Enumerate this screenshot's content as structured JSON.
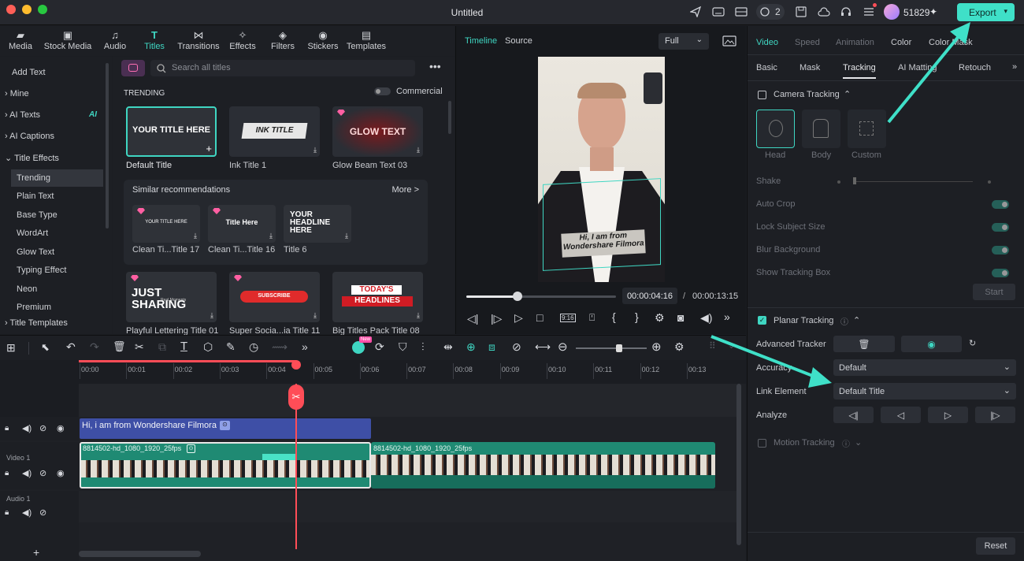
{
  "window": {
    "title": "Untitled",
    "count": "2",
    "credits": "51829",
    "export_label": "Export"
  },
  "colors": {
    "accent": "#3fd6c2",
    "export_bg": "#3fe0c8",
    "title_clip": "#3e4fa6",
    "video_clip": "#1f8a73",
    "playhead": "#ff4d57"
  },
  "media_tabs": [
    {
      "label": "Media",
      "icon": "folder-icon"
    },
    {
      "label": "Stock Media",
      "icon": "stock-icon"
    },
    {
      "label": "Audio",
      "icon": "music-icon"
    },
    {
      "label": "Titles",
      "icon": "title-icon"
    },
    {
      "label": "Transitions",
      "icon": "transition-icon"
    },
    {
      "label": "Effects",
      "icon": "effects-icon"
    },
    {
      "label": "Filters",
      "icon": "filters-icon"
    },
    {
      "label": "Stickers",
      "icon": "stickers-icon"
    },
    {
      "label": "Templates",
      "icon": "templates-icon"
    }
  ],
  "left_nav": {
    "add_text": "Add Text",
    "mine": "Mine",
    "ai_texts": "AI Texts",
    "ai_badge": "AI",
    "ai_captions": "AI Captions",
    "title_effects": "Title Effects",
    "sub": [
      "Trending",
      "Plain Text",
      "Base Type",
      "WordArt",
      "Glow Text",
      "Typing Effect",
      "Neon",
      "Premium"
    ],
    "title_templates": "Title Templates"
  },
  "titles": {
    "search_placeholder": "Search all titles",
    "commercial": "Commercial",
    "trending": "TRENDING",
    "similar": "Similar recommendations",
    "more": "More >",
    "row1": [
      {
        "caption": "Default Title",
        "preview": "YOUR TITLE HERE"
      },
      {
        "caption": "Ink Title 1",
        "preview": "INK TITLE"
      },
      {
        "caption": "Glow Beam Text 03",
        "preview": "GLOW TEXT"
      }
    ],
    "similar_items": [
      {
        "caption": "Clean Ti...Title 17",
        "preview": "YOUR TITLE HERE"
      },
      {
        "caption": "Clean Ti...Title 16",
        "preview": "Title Here"
      },
      {
        "caption": "Title 6",
        "preview": "YOUR HEADLINE HERE"
      }
    ],
    "row3": [
      {
        "caption": "Playful Lettering Title 01",
        "preview": "JUST SHARING",
        "small": "Real Moments"
      },
      {
        "caption": "Super Socia...ia Title 11",
        "preview": "SUBSCRIBE"
      },
      {
        "caption": "Big Titles Pack Title 08",
        "preview1": "TODAY'S",
        "preview2": "HEADLINES"
      }
    ]
  },
  "preview": {
    "tab_timeline": "Timeline",
    "tab_source": "Source",
    "quality": "Full",
    "overlay_text": "Hi, I am from Wondershare Filmora",
    "current_time": "00:00:04:16",
    "separator": "/",
    "total_time": "00:00:13:15",
    "progress": 0.34
  },
  "inspector": {
    "tabs1": [
      "Video",
      "Speed",
      "Animation",
      "Color",
      "Color Mask"
    ],
    "tabs2": [
      "Basic",
      "Mask",
      "Tracking",
      "AI Matting",
      "Retouch"
    ],
    "camera_tracking": "Camera Tracking",
    "modes": [
      "Head",
      "Body",
      "Custom"
    ],
    "shake": "Shake",
    "auto_crop": "Auto Crop",
    "lock_subject": "Lock Subject Size",
    "blur_bg": "Blur Background",
    "show_box": "Show Tracking Box",
    "start": "Start",
    "planar": "Planar Tracking",
    "advanced": "Advanced Tracker",
    "accuracy": "Accuracy",
    "accuracy_val": "Default",
    "link": "Link Element",
    "link_val": "Default Title",
    "analyze": "Analyze",
    "motion": "Motion Tracking",
    "reset": "Reset"
  },
  "timeline": {
    "ticks": [
      "00:00",
      "00:01",
      "00:02",
      "00:03",
      "00:04",
      "00:05",
      "00:06",
      "00:07",
      "00:08",
      "00:09",
      "00:10",
      "00:11",
      "00:12",
      "00:13"
    ],
    "title_clip": "Hi, i am from Wondershare Filmora",
    "video_clip1": "8814502-hd_1080_1920_25fps",
    "video_clip2": "8814502-hd_1080_1920_25fps",
    "track_video": "Video 1",
    "track_audio": "Audio 1",
    "new_badge": "New"
  }
}
